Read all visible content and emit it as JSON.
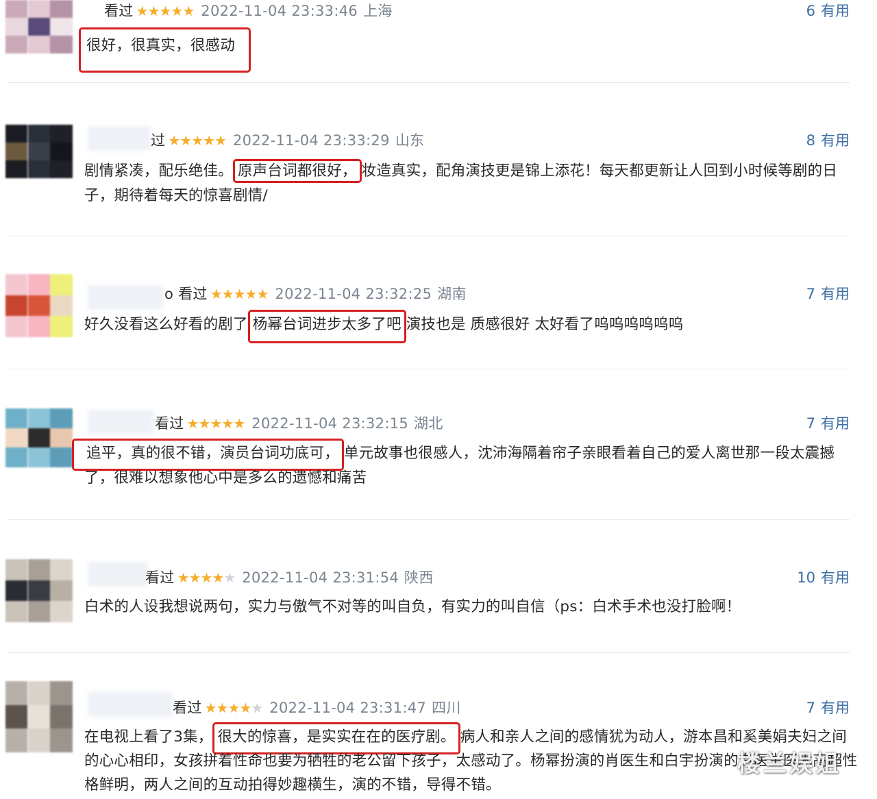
{
  "reviews": [
    {
      "status": "看过",
      "stars": 5,
      "date": "2022-11-04 23:33:46",
      "location": "上海",
      "useful_count": "6",
      "useful_label": "有用",
      "before": "",
      "highlight": "很好，很真实，很感动",
      "after": "",
      "avatar_colors": [
        "#c9a9b8",
        "#e3c9d2",
        "#b692a6",
        "#e8d7dd",
        "#5a4a7a",
        "#f0e6ea"
      ]
    },
    {
      "status": "过",
      "stars": 5,
      "date": "2022-11-04 23:33:29",
      "location": "山东",
      "useful_count": "8",
      "useful_label": "有用",
      "before": "剧情紧凑，配乐绝佳。",
      "highlight": "原声台词都很好，",
      "after": "妆造真实，配角演技更是锦上添花！每天都更新让人回到小时候等剧的日子，期待着每天的惊喜剧情/",
      "avatar_colors": [
        "#1b1c22",
        "#2a2f3a",
        "#1f2028",
        "#6b5a3e",
        "#3b3f4a",
        "#15161c"
      ]
    },
    {
      "status": "o 看过",
      "stars": 5,
      "date": "2022-11-04 23:32:25",
      "location": "湖南",
      "useful_count": "7",
      "useful_label": "有用",
      "before": "好久没看这么好看的剧了",
      "highlight": "杨幂台词进步太多了吧",
      "after": "演技也是 质感很好 太好看了呜呜呜呜呜呜",
      "avatar_colors": [
        "#f3c6d0",
        "#f7b6c2",
        "#eef07a",
        "#c8442e",
        "#d9553a",
        "#e9d9c3"
      ]
    },
    {
      "status": "看过",
      "stars": 5,
      "date": "2022-11-04 23:32:15",
      "location": "湖北",
      "useful_count": "7",
      "useful_label": "有用",
      "before": "",
      "highlight": "追平，真的很不错，演员台词功底可，",
      "after": "单元故事也很感人，沈沛海隔着帘子亲眼看着自己的爱人离世那一段太震撼了，很难以想象他心中是多么的遗憾和痛苦",
      "avatar_colors": [
        "#6fb0c9",
        "#8cc3d6",
        "#5e9db8",
        "#f2d9c4",
        "#2b2b2b",
        "#e7c8ae"
      ]
    },
    {
      "status": "看过",
      "stars": 4,
      "date": "2022-11-04 23:31:54",
      "location": "陕西",
      "useful_count": "10",
      "useful_label": "有用",
      "before": "白术的人设我想说两句，实力与傲气不对等的叫自负，有实力的叫自信（ps：白术手术也没打脸啊！",
      "highlight": "",
      "after": "",
      "avatar_colors": [
        "#c9c2b8",
        "#a8a096",
        "#dcd5cb",
        "#2a2c33",
        "#3a3c44",
        "#b8b0a5"
      ]
    },
    {
      "status": "看过",
      "stars": 4,
      "date": "2022-11-04 23:31:47",
      "location": "四川",
      "useful_count": "7",
      "useful_label": "有用",
      "before": "在电视上看了3集，",
      "highlight": "很大的惊喜，是实实在在的医疗剧。",
      "after": "病人和亲人之间的感情犹为动人，游本昌和奚美娟夫妇之间的心心相印，女孩拼着性命也要为牺牲的老公留下孩子，太感动了。杨幂扮演的肖医生和白宇扮演的白医生医术高超性格鲜明，两人之间的互动拍得妙趣横生，演的不错，导得不错。",
      "avatar_colors": [
        "#b7b0a8",
        "#d8d2ca",
        "#9c958d",
        "#5a524b",
        "#e6e0d8",
        "#7a736c"
      ]
    }
  ],
  "watermark": "楼兰娱姐"
}
